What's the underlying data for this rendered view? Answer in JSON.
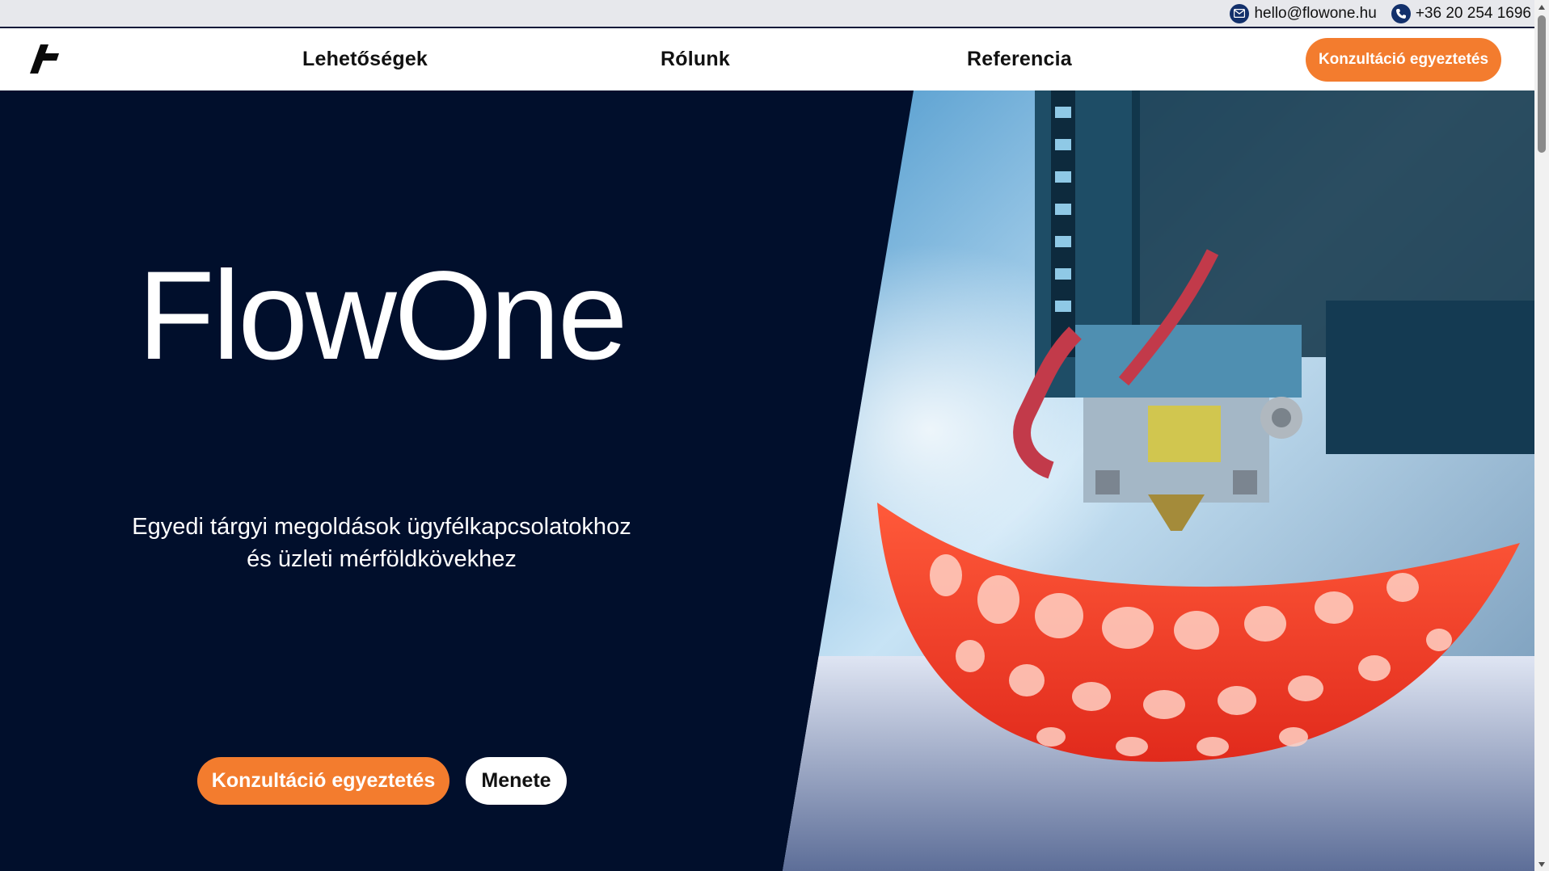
{
  "contact": {
    "email": "hello@flowone.hu",
    "phone": "+36 20 254 1696"
  },
  "nav": {
    "items": [
      {
        "label": "Lehetőségek"
      },
      {
        "label": "Rólunk"
      },
      {
        "label": "Referencia"
      }
    ],
    "cta_label": "Konzultáció egyeztetés"
  },
  "hero": {
    "title": "FlowOne",
    "subtitle_line1": "Egyedi tárgyi megoldások ügyfélkapcsolatokhoz",
    "subtitle_line2": "és üzleti mérföldkövekhez",
    "primary_label": "Konzultáció egyeztetés",
    "secondary_label": "Menete"
  },
  "colors": {
    "accent": "#f37c2e",
    "hero_bg": "#010f2c",
    "icon_bg": "#12306b"
  },
  "icons": [
    "mail-icon",
    "phone-icon",
    "flowone-logo-icon",
    "3d-printer-photo"
  ]
}
